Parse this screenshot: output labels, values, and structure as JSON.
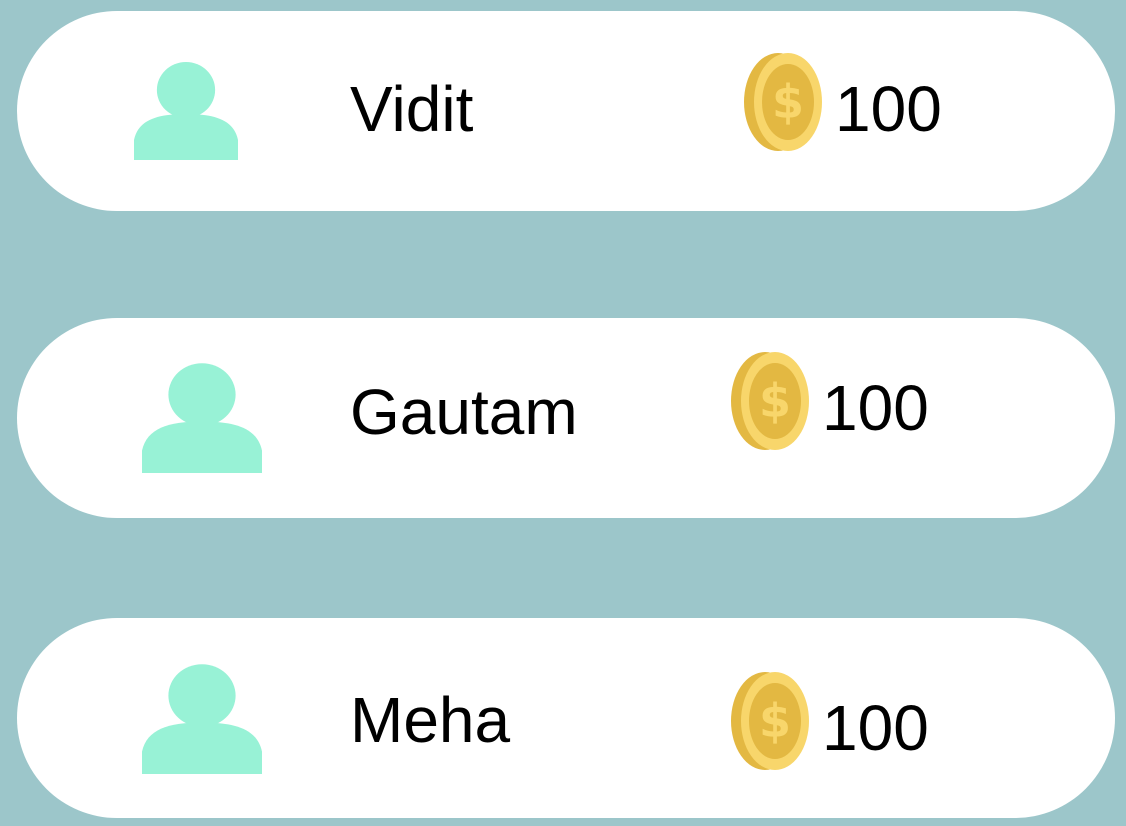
{
  "colors": {
    "background": "#9CC6CA",
    "card": "#FFFFFF",
    "avatar": "#98F2D6",
    "coin_face": "#E3B842",
    "coin_edge": "#F8D66B",
    "coin_symbol": "#F8D66B",
    "text": "#000000"
  },
  "players": [
    {
      "name": "Vidit",
      "coins": "100",
      "avatar_icon": "user-icon",
      "coin_icon": "dollar-coin-icon"
    },
    {
      "name": "Gautam",
      "coins": "100",
      "avatar_icon": "user-icon",
      "coin_icon": "dollar-coin-icon"
    },
    {
      "name": "Meha",
      "coins": "100",
      "avatar_icon": "user-icon",
      "coin_icon": "dollar-coin-icon"
    }
  ]
}
